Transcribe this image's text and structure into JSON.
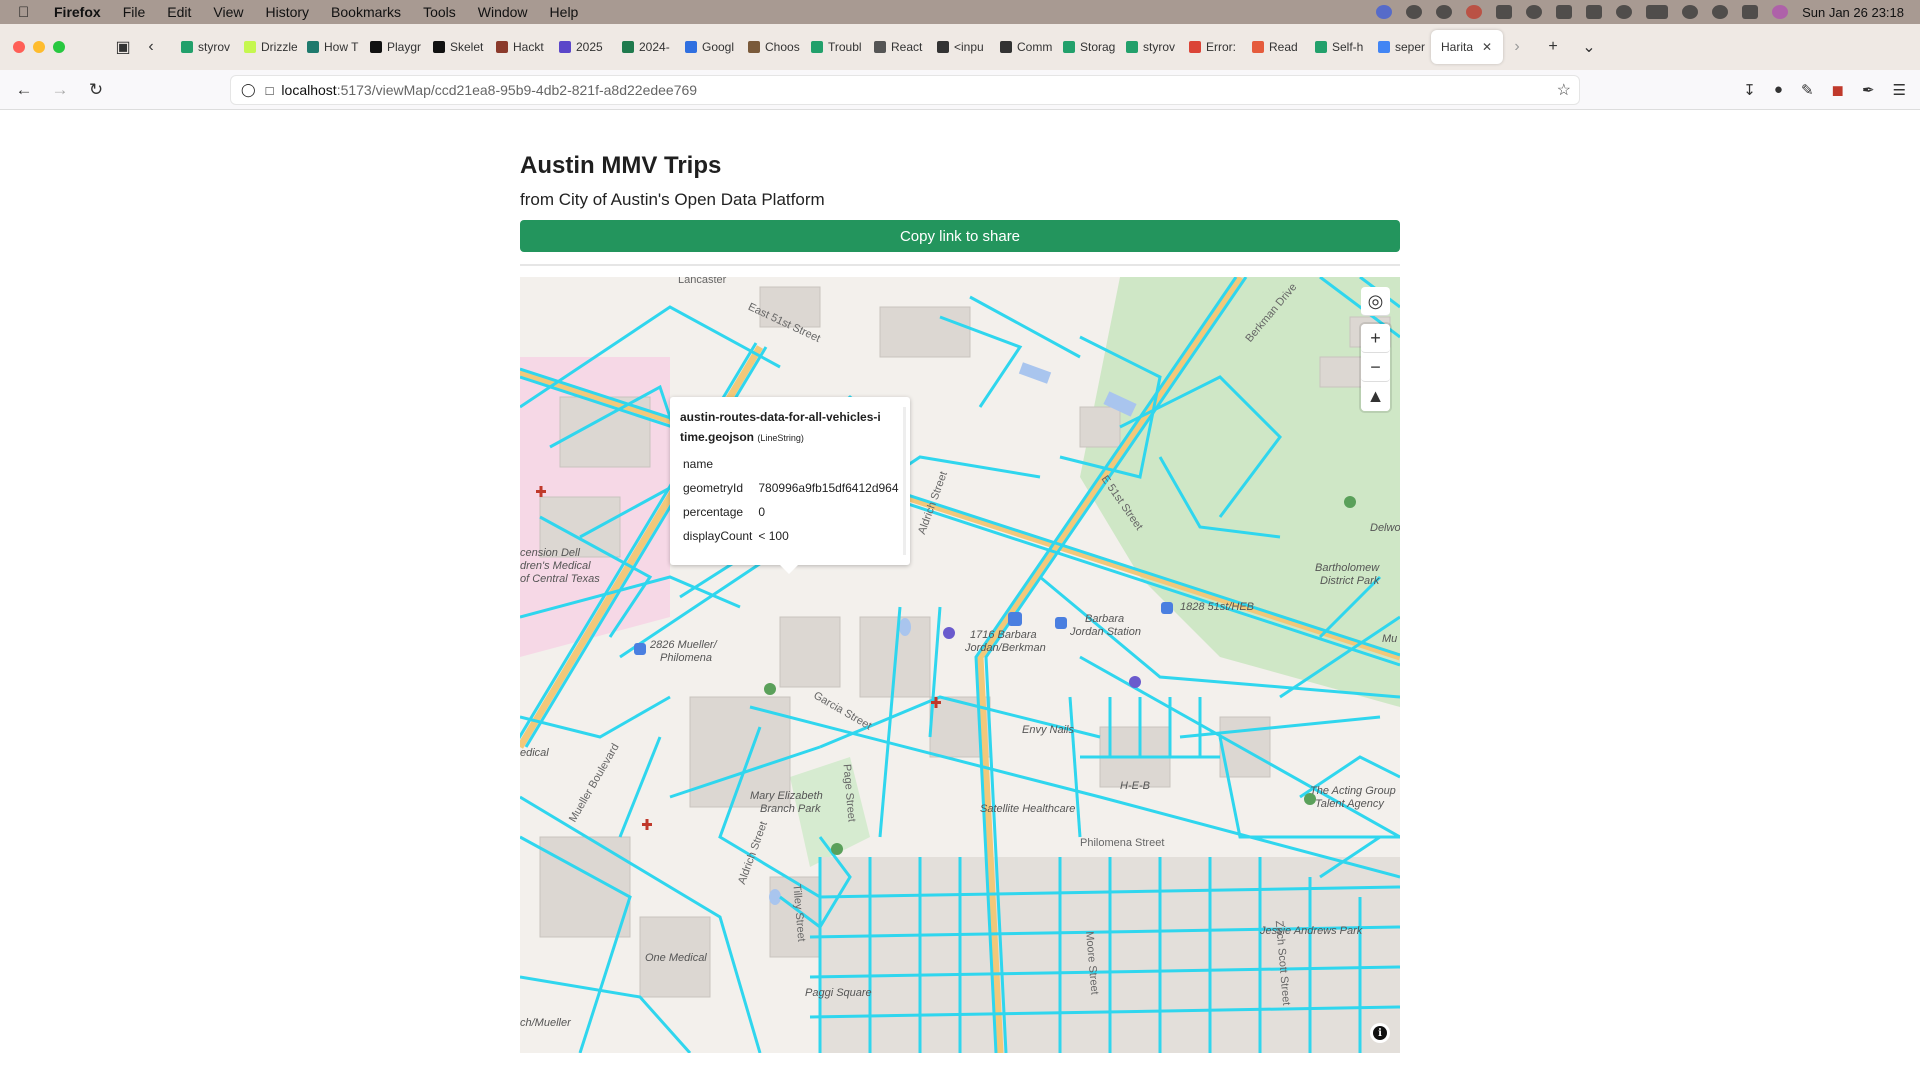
{
  "menubar": {
    "app": "Firefox",
    "items": [
      "File",
      "Edit",
      "View",
      "History",
      "Bookmarks",
      "Tools",
      "Window",
      "Help"
    ],
    "clock": "Sun Jan 26  23:18"
  },
  "tabs": [
    {
      "label": "styrov",
      "color": "#22a06b"
    },
    {
      "label": "Drizzle",
      "color": "#c5f74f"
    },
    {
      "label": "How T",
      "color": "#1f7a6d"
    },
    {
      "label": "Playgr",
      "color": "#111111"
    },
    {
      "label": "Skelet",
      "color": "#111111"
    },
    {
      "label": "Hackt",
      "color": "#8b3a2b"
    },
    {
      "label": "2025",
      "color": "#5b46c9"
    },
    {
      "label": "2024-",
      "color": "#1f7a4d"
    },
    {
      "label": "Googl",
      "color": "#2f6fe0"
    },
    {
      "label": "Choos",
      "color": "#7a5a3a"
    },
    {
      "label": "Troubl",
      "color": "#22a06b"
    },
    {
      "label": "React",
      "color": "#555555"
    },
    {
      "label": "<inpu",
      "color": "#333333"
    },
    {
      "label": "Comm",
      "color": "#333333"
    },
    {
      "label": "Storag",
      "color": "#22a06b"
    },
    {
      "label": "styrov",
      "color": "#22a06b"
    },
    {
      "label": "Error:",
      "color": "#db4437"
    },
    {
      "label": "Read",
      "color": "#e55b3c"
    },
    {
      "label": "Self-h",
      "color": "#22a06b"
    },
    {
      "label": "seper",
      "color": "#4285f4"
    },
    {
      "label": "Harita",
      "color": "#ffffff",
      "active": true
    }
  ],
  "urlbar": {
    "host": "localhost",
    "path": ":5173/viewMap/ccd21ea8-95b9-4db2-821f-a8d22edee769"
  },
  "page": {
    "title": "Austin MMV Trips",
    "subtitle": "from City of Austin's Open Data Platform",
    "copy_button": "Copy link to share"
  },
  "popup": {
    "title_line1": "austin-routes-data-for-all-vehicles-i",
    "title_line2": "time.geojson",
    "geometry_type": "(LineString)",
    "rows": [
      {
        "key": "name",
        "value": ""
      },
      {
        "key": "geometryId",
        "value": "780996a9fb15df6412d964"
      },
      {
        "key": "percentage",
        "value": "0"
      },
      {
        "key": "displayCount",
        "value": "< 100"
      }
    ]
  },
  "map": {
    "route_color": "#2fd6ee",
    "labels": {
      "east51": "East 51st Street",
      "berkman": "Berkman Drive",
      "aldrich": "Aldrich Street",
      "e51": "E 51st Street",
      "delwood": "Delwo",
      "bartholomew": "Bartholomew",
      "bartholomew2": "District Park",
      "mu": "Mu",
      "stop1828": "1828 51st/HEB",
      "barbara1": "Barbara",
      "barbara2": "Jordan Station",
      "stop1716a": "1716 Barbara",
      "stop1716b": "Jordan/Berkman",
      "stop2826a": "2826 Mueller/",
      "stop2826b": "Philomena",
      "dell1": "cension Dell",
      "dell2": "dren's Medical",
      "dell3": "of Central Texas",
      "garcia": "Garcia Street",
      "envy": "Envy Nails",
      "heb": "H-E-B",
      "mary1": "Mary Elizabeth",
      "mary2": "Branch Park",
      "page_st": "Page Street",
      "satellite": "Satellite Healthcare",
      "philomena": "Philomena Street",
      "acting1": "The Acting Group",
      "acting2": "Talent Agency",
      "jessie": "Jessie Andrews Park",
      "aldrich2": "Aldrich Street",
      "mueller_blvd": "Mueller Boulevard",
      "dedicated": "edical",
      "one_medical": "One Medical",
      "paggi": "Paggi Square",
      "tilley": "Tilley Street",
      "moore": "Moore Street",
      "zach": "Zach Scott Street",
      "muller2": "ch/Mueller",
      "ch2": "ch/Mueller",
      "lancaster": "Lancaster"
    }
  }
}
